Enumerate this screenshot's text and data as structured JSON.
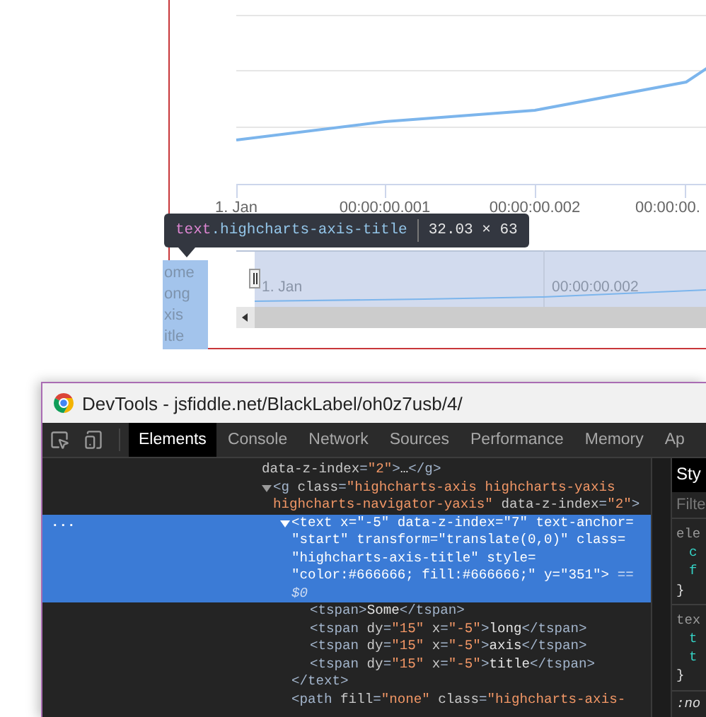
{
  "chart": {
    "x_labels": [
      "1. Jan",
      "00:00:00.001",
      "00:00:00.002",
      "00:00:00."
    ]
  },
  "navigator": {
    "labels": [
      "1. Jan",
      "00:00:00.002"
    ]
  },
  "highlight_overlay": {
    "lines": [
      "ome",
      "ong",
      "xis",
      "itle"
    ]
  },
  "inspect_tooltip": {
    "tag": "text",
    "class_name": ".highcharts-axis-title",
    "size": "32.03 × 63"
  },
  "devtools": {
    "title": "DevTools - jsfiddle.net/BlackLabel/oh0z7usb/4/",
    "tabs": [
      {
        "label": "Elements",
        "selected": true
      },
      {
        "label": "Console",
        "selected": false
      },
      {
        "label": "Network",
        "selected": false
      },
      {
        "label": "Sources",
        "selected": false
      },
      {
        "label": "Performance",
        "selected": false
      },
      {
        "label": "Memory",
        "selected": false
      },
      {
        "label": "Ap",
        "selected": false
      }
    ],
    "elements": {
      "nodes": [
        {
          "kind": "fragment",
          "selected": false,
          "tokens": [
            {
              "kind": "attr",
              "text": "data-z-index"
            },
            {
              "kind": "tag",
              "text": "="
            },
            {
              "kind": "value",
              "text": "\"2\""
            },
            {
              "kind": "tag",
              "text": ">"
            },
            {
              "kind": "text",
              "text": "…"
            },
            {
              "kind": "tag",
              "text": "</g>"
            }
          ]
        },
        {
          "kind": "branch",
          "expanded": true,
          "selected": false,
          "tokens": [
            {
              "kind": "tag",
              "text": "<g"
            },
            {
              "kind": "attr",
              "text": " class"
            },
            {
              "kind": "tag",
              "text": "="
            },
            {
              "kind": "value",
              "text": "\"highcharts-axis highcharts-yaxis highcharts-navigator-yaxis\""
            },
            {
              "kind": "attr",
              "text": " data-z-index"
            },
            {
              "kind": "tag",
              "text": "="
            },
            {
              "kind": "value",
              "text": "\"2\""
            },
            {
              "kind": "tag",
              "text": ">"
            }
          ],
          "children": [
            {
              "kind": "branch",
              "expanded": true,
              "selected": true,
              "menu": "...",
              "tokens": [
                {
                  "kind": "tag",
                  "text": "<text"
                },
                {
                  "kind": "attr",
                  "text": " x"
                },
                {
                  "kind": "tag",
                  "text": "="
                },
                {
                  "kind": "value",
                  "text": "\"-5\""
                },
                {
                  "kind": "attr",
                  "text": " data-z-index"
                },
                {
                  "kind": "tag",
                  "text": "="
                },
                {
                  "kind": "value",
                  "text": "\"7\""
                },
                {
                  "kind": "attr",
                  "text": " text-anchor"
                },
                {
                  "kind": "tag",
                  "text": "="
                },
                {
                  "kind": "value",
                  "text": "\"start\""
                },
                {
                  "kind": "attr",
                  "text": " transform"
                },
                {
                  "kind": "tag",
                  "text": "="
                },
                {
                  "kind": "value",
                  "text": "\"translate(0,0)\""
                },
                {
                  "kind": "attr",
                  "text": " class"
                },
                {
                  "kind": "tag",
                  "text": "="
                },
                {
                  "kind": "value",
                  "text": "\"highcharts-axis-title\""
                },
                {
                  "kind": "attr",
                  "text": " style"
                },
                {
                  "kind": "tag",
                  "text": "="
                },
                {
                  "kind": "value",
                  "text": "\"color:#666666; fill:#666666;\""
                },
                {
                  "kind": "attr",
                  "text": " y"
                },
                {
                  "kind": "tag",
                  "text": "="
                },
                {
                  "kind": "value",
                  "text": "\"351\""
                },
                {
                  "kind": "tag",
                  "text": ">"
                },
                {
                  "kind": "marker",
                  "text": " == $0"
                }
              ],
              "closing": [
                {
                  "kind": "tag",
                  "text": "</text>"
                }
              ],
              "children": [
                {
                  "kind": "leaf",
                  "selected": false,
                  "tokens": [
                    {
                      "kind": "tag",
                      "text": "<tspan>"
                    },
                    {
                      "kind": "text",
                      "text": "Some"
                    },
                    {
                      "kind": "tag",
                      "text": "</tspan>"
                    }
                  ]
                },
                {
                  "kind": "leaf",
                  "selected": false,
                  "tokens": [
                    {
                      "kind": "tag",
                      "text": "<tspan"
                    },
                    {
                      "kind": "attr",
                      "text": " dy"
                    },
                    {
                      "kind": "tag",
                      "text": "="
                    },
                    {
                      "kind": "value",
                      "text": "\"15\""
                    },
                    {
                      "kind": "attr",
                      "text": " x"
                    },
                    {
                      "kind": "tag",
                      "text": "="
                    },
                    {
                      "kind": "value",
                      "text": "\"-5\""
                    },
                    {
                      "kind": "tag",
                      "text": ">"
                    },
                    {
                      "kind": "text",
                      "text": "long"
                    },
                    {
                      "kind": "tag",
                      "text": "</tspan>"
                    }
                  ]
                },
                {
                  "kind": "leaf",
                  "selected": false,
                  "tokens": [
                    {
                      "kind": "tag",
                      "text": "<tspan"
                    },
                    {
                      "kind": "attr",
                      "text": " dy"
                    },
                    {
                      "kind": "tag",
                      "text": "="
                    },
                    {
                      "kind": "value",
                      "text": "\"15\""
                    },
                    {
                      "kind": "attr",
                      "text": " x"
                    },
                    {
                      "kind": "tag",
                      "text": "="
                    },
                    {
                      "kind": "value",
                      "text": "\"-5\""
                    },
                    {
                      "kind": "tag",
                      "text": ">"
                    },
                    {
                      "kind": "text",
                      "text": "axis"
                    },
                    {
                      "kind": "tag",
                      "text": "</tspan>"
                    }
                  ]
                },
                {
                  "kind": "leaf",
                  "selected": false,
                  "tokens": [
                    {
                      "kind": "tag",
                      "text": "<tspan"
                    },
                    {
                      "kind": "attr",
                      "text": " dy"
                    },
                    {
                      "kind": "tag",
                      "text": "="
                    },
                    {
                      "kind": "value",
                      "text": "\"15\""
                    },
                    {
                      "kind": "attr",
                      "text": " x"
                    },
                    {
                      "kind": "tag",
                      "text": "="
                    },
                    {
                      "kind": "value",
                      "text": "\"-5\""
                    },
                    {
                      "kind": "tag",
                      "text": ">"
                    },
                    {
                      "kind": "text",
                      "text": "title"
                    },
                    {
                      "kind": "tag",
                      "text": "</tspan>"
                    }
                  ]
                }
              ]
            },
            {
              "kind": "leaf",
              "selected": false,
              "tokens": [
                {
                  "kind": "tag",
                  "text": "<path"
                },
                {
                  "kind": "attr",
                  "text": " fill"
                },
                {
                  "kind": "tag",
                  "text": "="
                },
                {
                  "kind": "value",
                  "text": "\"none\""
                },
                {
                  "kind": "attr",
                  "text": " class"
                },
                {
                  "kind": "tag",
                  "text": "="
                },
                {
                  "kind": "value",
                  "text": "\"highcharts-axis-"
                }
              ]
            }
          ]
        }
      ]
    },
    "styles": {
      "tab": "Sty",
      "filter_placeholder": "Filte",
      "rules": [
        {
          "selector": "ele",
          "properties": [
            "c",
            "f"
          ],
          "close": "}"
        },
        {
          "selector": "tex",
          "properties": [
            "t",
            "t"
          ],
          "close": "}"
        }
      ],
      "next_selector": ":no"
    }
  }
}
